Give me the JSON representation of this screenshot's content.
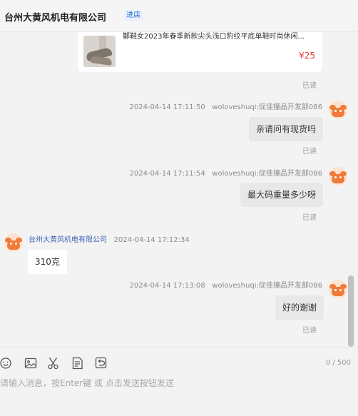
{
  "header": {
    "shop_name": "台州大黄风机电有限公司",
    "badge": "进店"
  },
  "product": {
    "title": "鄞鞋女2023年春季新款尖头浅口豹纹平底单鞋时尚休闲...",
    "price": "¥25",
    "read": "已读"
  },
  "messages": [
    {
      "time": "2024-04-14 17:11:50",
      "sender": "woloveshuqi:促佳撞品开发部086",
      "text": "亲请问有现货吗",
      "read": "已读"
    },
    {
      "time": "2024-04-14 17:11:54",
      "sender": "woloveshuqi:促佳撞品开发部086",
      "text": "最大码重量多少呀",
      "read": "已读"
    },
    {
      "time": "2024-04-14 17:12:34",
      "sender": "台州大黄风机电有限公司",
      "text": "310克"
    },
    {
      "time": "2024-04-14 17:13:08",
      "sender": "woloveshuqi:促佳撞品开发部086",
      "text": "好的谢谢",
      "read": "已读"
    }
  ],
  "composer": {
    "tools": [
      "emoji-icon",
      "image-icon",
      "scissors-icon",
      "document-icon",
      "recall-icon"
    ],
    "counter": "0 / 500",
    "placeholder": "请输入消息，按Enter键 或 点击发送按钮发送"
  },
  "colors": {
    "price": "#e53935",
    "shop_link": "#3c63b5",
    "avatar": "#f07a3a"
  }
}
